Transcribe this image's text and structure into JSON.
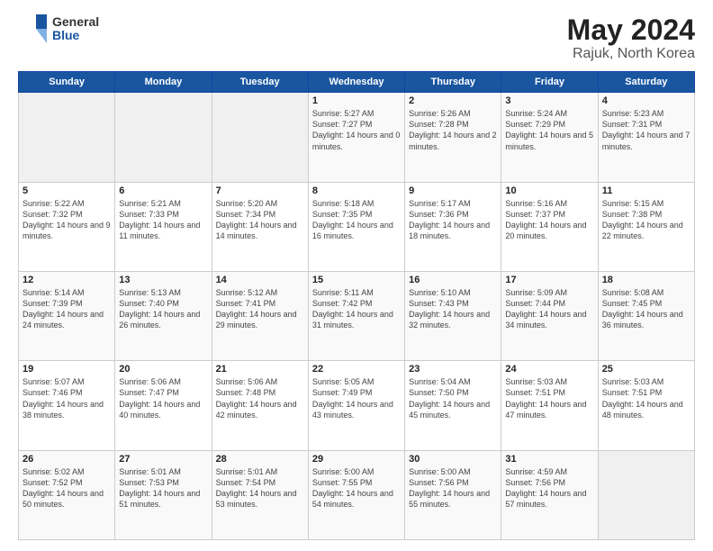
{
  "header": {
    "logo_general": "General",
    "logo_blue": "Blue",
    "month": "May 2024",
    "location": "Rajuk, North Korea"
  },
  "weekdays": [
    "Sunday",
    "Monday",
    "Tuesday",
    "Wednesday",
    "Thursday",
    "Friday",
    "Saturday"
  ],
  "weeks": [
    [
      {
        "day": "",
        "empty": true
      },
      {
        "day": "",
        "empty": true
      },
      {
        "day": "",
        "empty": true
      },
      {
        "day": "1",
        "sunrise": "5:27 AM",
        "sunset": "7:27 PM",
        "daylight": "14 hours and 0 minutes."
      },
      {
        "day": "2",
        "sunrise": "5:26 AM",
        "sunset": "7:28 PM",
        "daylight": "14 hours and 2 minutes."
      },
      {
        "day": "3",
        "sunrise": "5:24 AM",
        "sunset": "7:29 PM",
        "daylight": "14 hours and 5 minutes."
      },
      {
        "day": "4",
        "sunrise": "5:23 AM",
        "sunset": "7:31 PM",
        "daylight": "14 hours and 7 minutes."
      }
    ],
    [
      {
        "day": "5",
        "sunrise": "5:22 AM",
        "sunset": "7:32 PM",
        "daylight": "14 hours and 9 minutes."
      },
      {
        "day": "6",
        "sunrise": "5:21 AM",
        "sunset": "7:33 PM",
        "daylight": "14 hours and 11 minutes."
      },
      {
        "day": "7",
        "sunrise": "5:20 AM",
        "sunset": "7:34 PM",
        "daylight": "14 hours and 14 minutes."
      },
      {
        "day": "8",
        "sunrise": "5:18 AM",
        "sunset": "7:35 PM",
        "daylight": "14 hours and 16 minutes."
      },
      {
        "day": "9",
        "sunrise": "5:17 AM",
        "sunset": "7:36 PM",
        "daylight": "14 hours and 18 minutes."
      },
      {
        "day": "10",
        "sunrise": "5:16 AM",
        "sunset": "7:37 PM",
        "daylight": "14 hours and 20 minutes."
      },
      {
        "day": "11",
        "sunrise": "5:15 AM",
        "sunset": "7:38 PM",
        "daylight": "14 hours and 22 minutes."
      }
    ],
    [
      {
        "day": "12",
        "sunrise": "5:14 AM",
        "sunset": "7:39 PM",
        "daylight": "14 hours and 24 minutes."
      },
      {
        "day": "13",
        "sunrise": "5:13 AM",
        "sunset": "7:40 PM",
        "daylight": "14 hours and 26 minutes."
      },
      {
        "day": "14",
        "sunrise": "5:12 AM",
        "sunset": "7:41 PM",
        "daylight": "14 hours and 29 minutes."
      },
      {
        "day": "15",
        "sunrise": "5:11 AM",
        "sunset": "7:42 PM",
        "daylight": "14 hours and 31 minutes."
      },
      {
        "day": "16",
        "sunrise": "5:10 AM",
        "sunset": "7:43 PM",
        "daylight": "14 hours and 32 minutes."
      },
      {
        "day": "17",
        "sunrise": "5:09 AM",
        "sunset": "7:44 PM",
        "daylight": "14 hours and 34 minutes."
      },
      {
        "day": "18",
        "sunrise": "5:08 AM",
        "sunset": "7:45 PM",
        "daylight": "14 hours and 36 minutes."
      }
    ],
    [
      {
        "day": "19",
        "sunrise": "5:07 AM",
        "sunset": "7:46 PM",
        "daylight": "14 hours and 38 minutes."
      },
      {
        "day": "20",
        "sunrise": "5:06 AM",
        "sunset": "7:47 PM",
        "daylight": "14 hours and 40 minutes."
      },
      {
        "day": "21",
        "sunrise": "5:06 AM",
        "sunset": "7:48 PM",
        "daylight": "14 hours and 42 minutes."
      },
      {
        "day": "22",
        "sunrise": "5:05 AM",
        "sunset": "7:49 PM",
        "daylight": "14 hours and 43 minutes."
      },
      {
        "day": "23",
        "sunrise": "5:04 AM",
        "sunset": "7:50 PM",
        "daylight": "14 hours and 45 minutes."
      },
      {
        "day": "24",
        "sunrise": "5:03 AM",
        "sunset": "7:51 PM",
        "daylight": "14 hours and 47 minutes."
      },
      {
        "day": "25",
        "sunrise": "5:03 AM",
        "sunset": "7:51 PM",
        "daylight": "14 hours and 48 minutes."
      }
    ],
    [
      {
        "day": "26",
        "sunrise": "5:02 AM",
        "sunset": "7:52 PM",
        "daylight": "14 hours and 50 minutes."
      },
      {
        "day": "27",
        "sunrise": "5:01 AM",
        "sunset": "7:53 PM",
        "daylight": "14 hours and 51 minutes."
      },
      {
        "day": "28",
        "sunrise": "5:01 AM",
        "sunset": "7:54 PM",
        "daylight": "14 hours and 53 minutes."
      },
      {
        "day": "29",
        "sunrise": "5:00 AM",
        "sunset": "7:55 PM",
        "daylight": "14 hours and 54 minutes."
      },
      {
        "day": "30",
        "sunrise": "5:00 AM",
        "sunset": "7:56 PM",
        "daylight": "14 hours and 55 minutes."
      },
      {
        "day": "31",
        "sunrise": "4:59 AM",
        "sunset": "7:56 PM",
        "daylight": "14 hours and 57 minutes."
      },
      {
        "day": "",
        "empty": true
      }
    ]
  ]
}
